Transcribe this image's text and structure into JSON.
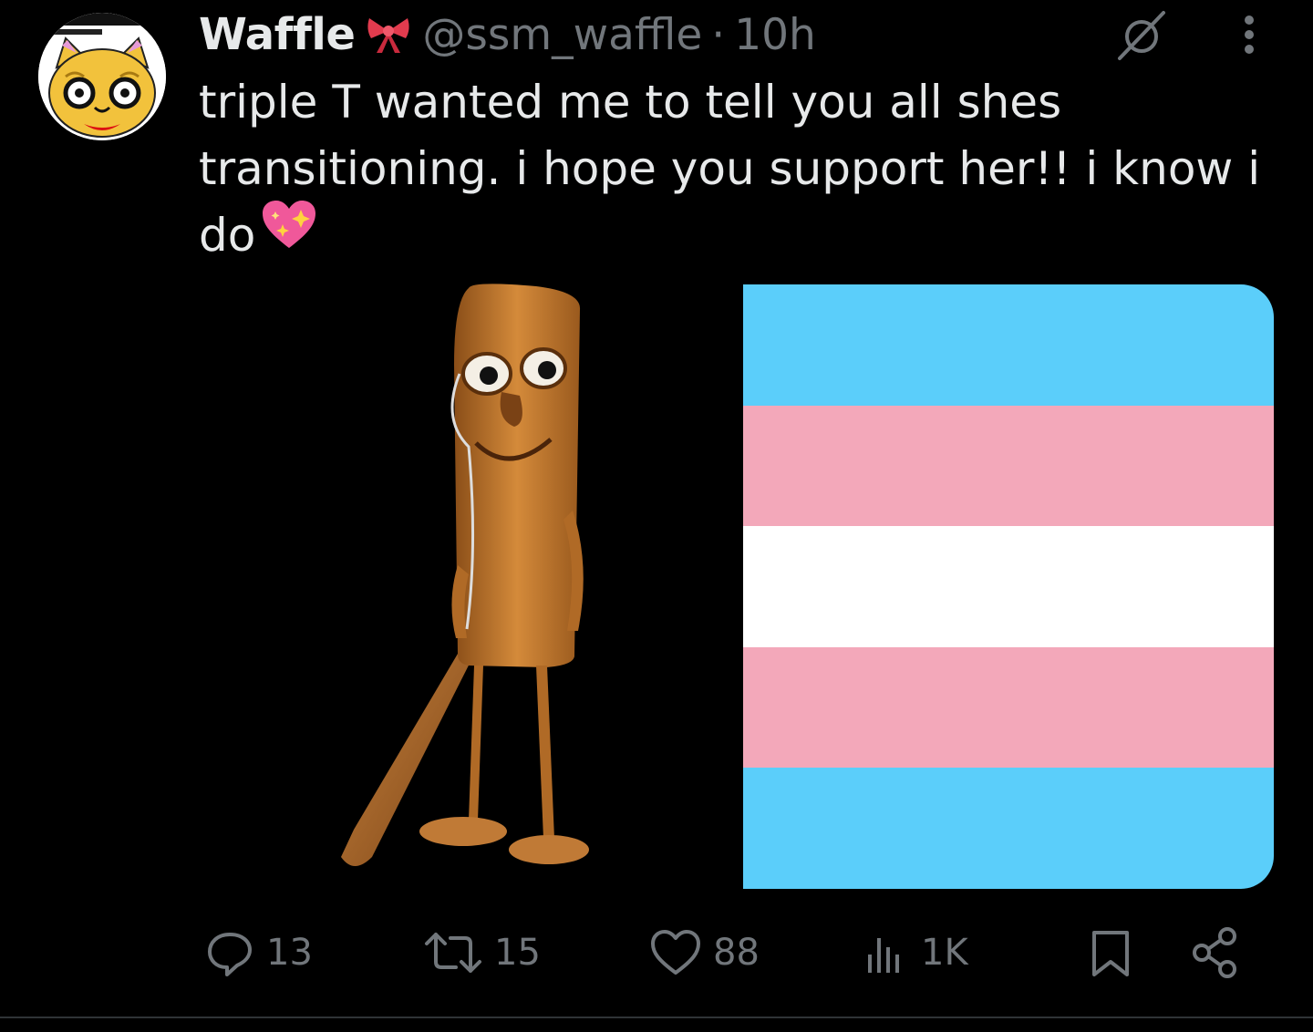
{
  "post": {
    "display_name": "Waffle",
    "handle": "@ssm_waffle",
    "separator": "·",
    "time": "10h",
    "text": "triple T wanted me to tell you all shes transitioning. i hope you support her!! i know i do",
    "emoji_after_name": "ribbon-emoji",
    "emoji_after_text": "sparkling-heart-emoji"
  },
  "media": {
    "left_image": "wooden-figure-with-baseball-bat",
    "right_image": "transgender-pride-flag",
    "flag_colors": [
      "#5BCEFA",
      "#F5A9B8",
      "#FFFFFF",
      "#F5A9B8",
      "#5BCEFA"
    ]
  },
  "actions": {
    "replies": "13",
    "reposts": "15",
    "likes": "88",
    "views": "1K"
  },
  "colors": {
    "background": "#000000",
    "primary_text": "#e7e9ea",
    "secondary_text": "#71767b"
  }
}
